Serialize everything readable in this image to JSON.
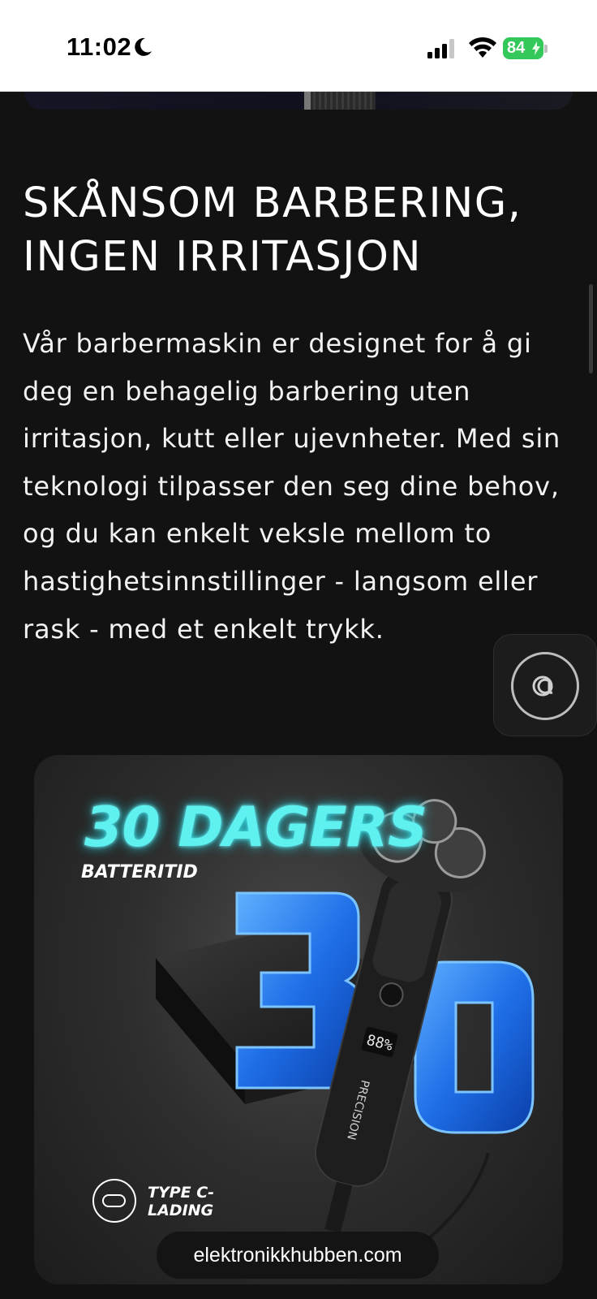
{
  "status_bar": {
    "time": "11:02",
    "battery": "84"
  },
  "article": {
    "heading": "SKÅNSOM BARBERING, INGEN IRRITASJON",
    "body": "Vår barbermaskin er designet for å gi deg en behagelig barbering uten irritasjon, kutt eller ujevnheter. Med sin teknologi tilpasser den seg dine behov, og du kan enkelt veksle mellom to hastighetsinnstillinger - langsom eller rask - med et enkelt trykk."
  },
  "promo": {
    "title": "30 DAGERS",
    "subtitle": "BATTERITID",
    "big_number": "30",
    "display_reading": "88%",
    "brand_on_device": "PRECISION",
    "charging_label": "TYPE C- LADING"
  },
  "browser": {
    "url": "elektronikkhubben.com"
  },
  "icons": {
    "moon": "moon-icon",
    "signal": "cellular-signal-icon",
    "wifi": "wifi-icon",
    "battery": "battery-icon",
    "chat": "chat-assistant-icon",
    "usb": "usb-c-icon"
  },
  "colors": {
    "background": "#121212",
    "accent_cyan": "#5ff0f0",
    "accent_blue": "#2a86ff",
    "battery_green": "#34c759"
  }
}
